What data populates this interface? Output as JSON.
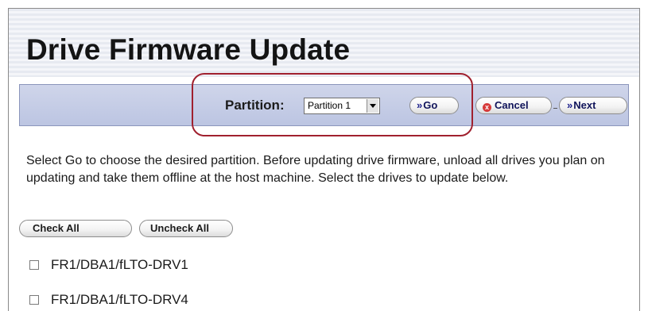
{
  "page": {
    "title": "Drive Firmware Update"
  },
  "toolbar": {
    "partition_label": "Partition:",
    "partition_selected": "Partition 1",
    "go_label": "Go",
    "cancel_label": "Cancel",
    "next_label": "Next",
    "chevron_glyph": "»",
    "cancel_glyph": "x"
  },
  "instructions": "Select Go to choose the desired partition. Before updating drive firmware, unload all drives you plan on updating and take them offline at the host machine. Select the drives to update below.",
  "selection": {
    "check_all_label": "Check All",
    "uncheck_all_label": "Uncheck All"
  },
  "drives": [
    {
      "label": "FR1/DBA1/fLTO-DRV1",
      "checked": false
    },
    {
      "label": "FR1/DBA1/fLTO-DRV4",
      "checked": false
    }
  ],
  "colors": {
    "toolbar_bg": "#bcc5e2",
    "button_text": "#10145a",
    "highlight_ring": "#a0202e",
    "cancel_icon": "#d63a3a"
  }
}
